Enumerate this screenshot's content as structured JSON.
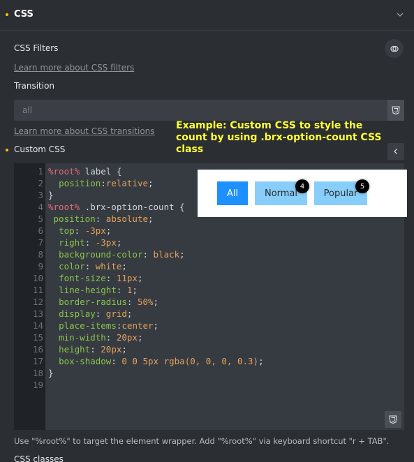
{
  "section": {
    "title": "CSS"
  },
  "filters": {
    "label": "CSS Filters",
    "link": "Learn more about CSS filters"
  },
  "transition": {
    "label": "Transition",
    "placeholder": "all",
    "link": "Learn more about CSS transitions"
  },
  "custom_css": {
    "label": "Custom CSS"
  },
  "annotation": "Example: Custom CSS to style the count by using .brx-option-count CSS class",
  "editor": {
    "line_numbers": [
      "1",
      "2",
      "3",
      "4",
      "5",
      "6",
      "7",
      "8",
      "9",
      "10",
      "11",
      "12",
      "13",
      "14",
      "15",
      "16",
      "17",
      "18",
      "19"
    ],
    "lines": [
      "%root% label {",
      "  position:relative;",
      "}",
      "",
      "%root% .brx-option-count {",
      " position: absolute;",
      "  top: -3px;",
      "  right: -3px;",
      "  background-color: black;",
      "  color: white;",
      "  font-size: 11px;",
      "  line-height: 1;",
      "  border-radius: 50%;",
      "  display: grid;",
      "  place-items:center;",
      "  min-width: 20px;",
      "  height: 20px;",
      "  box-shadow: 0 0 5px rgba(0, 0, 0, 0.3);",
      "}"
    ]
  },
  "preview": {
    "buttons": [
      {
        "label": "All",
        "count": ""
      },
      {
        "label": "Normal",
        "count": "4"
      },
      {
        "label": "Popular",
        "count": "5"
      }
    ]
  },
  "help_text": "Use \"%root%\" to target the element wrapper. Add \"%root%\" via keyboard shortcut \"r + TAB\".",
  "classes_label": "CSS classes",
  "colors": {
    "accent": "#ffc107",
    "annotation": "#ffff33",
    "active_button": "#1e90ff",
    "button": "#87cefa"
  },
  "icons": [
    "chevron-down-icon",
    "filter-icon",
    "css3-icon",
    "chevron-left-icon"
  ]
}
